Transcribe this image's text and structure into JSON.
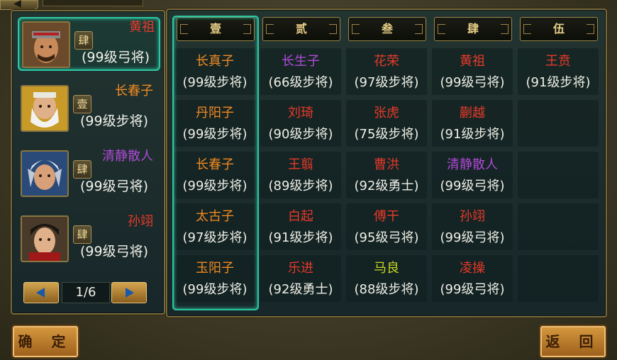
{
  "colors": {
    "red": "#e63a2a",
    "orange": "#f08a22",
    "purple": "#b04ad8",
    "yellow": "#c8d820",
    "teal": "#2cc6a2"
  },
  "confirm_label": "确 定",
  "back_label": "返 回",
  "hero_list": [
    {
      "name": "黄祖",
      "name_color": "red",
      "rank": "肆",
      "level": "(99级弓将)",
      "selected": true,
      "portrait": "warrior-red-headband-portrait"
    },
    {
      "name": "长春子",
      "name_color": "orange",
      "rank": "壹",
      "level": "(99级步将)",
      "selected": false,
      "portrait": "white-beard-elder-portrait"
    },
    {
      "name": "清静散人",
      "name_color": "purple",
      "rank": "肆",
      "level": "(99级弓将)",
      "selected": false,
      "portrait": "blue-helmet-warrior-portrait"
    },
    {
      "name": "孙翊",
      "name_color": "red",
      "rank": "肆",
      "level": "(99级弓将)",
      "selected": false,
      "portrait": "young-general-portrait"
    }
  ],
  "pager": {
    "text": "1/6"
  },
  "columns": [
    {
      "header": "壹",
      "cells": [
        {
          "name": "长真子",
          "color": "orange",
          "level": "(99级步将)"
        },
        {
          "name": "丹阳子",
          "color": "orange",
          "level": "(99级步将)"
        },
        {
          "name": "长春子",
          "color": "orange",
          "level": "(99级步将)"
        },
        {
          "name": "太古子",
          "color": "orange",
          "level": "(97级步将)"
        },
        {
          "name": "玉阳子",
          "color": "orange",
          "level": "(99级步将)"
        }
      ]
    },
    {
      "header": "贰",
      "cells": [
        {
          "name": "长生子",
          "color": "purple",
          "level": "(66级步将)"
        },
        {
          "name": "刘琦",
          "color": "red",
          "level": "(90级步将)"
        },
        {
          "name": "王翦",
          "color": "red",
          "level": "(89级步将)"
        },
        {
          "name": "白起",
          "color": "red",
          "level": "(91级步将)"
        },
        {
          "name": "乐进",
          "color": "red",
          "level": "(92级勇士)"
        }
      ]
    },
    {
      "header": "叁",
      "cells": [
        {
          "name": "花荣",
          "color": "red",
          "level": "(97级步将)"
        },
        {
          "name": "张虎",
          "color": "red",
          "level": "(75级步将)"
        },
        {
          "name": "曹洪",
          "color": "red",
          "level": "(92级勇士)"
        },
        {
          "name": "傅干",
          "color": "red",
          "level": "(95级弓将)"
        },
        {
          "name": "马良",
          "color": "yellow",
          "level": "(88级步将)"
        }
      ]
    },
    {
      "header": "肆",
      "cells": [
        {
          "name": "黄祖",
          "color": "red",
          "level": "(99级弓将)"
        },
        {
          "name": "蒯越",
          "color": "red",
          "level": "(91级步将)"
        },
        {
          "name": "清静散人",
          "color": "purple",
          "level": "(99级弓将)"
        },
        {
          "name": "孙翊",
          "color": "red",
          "level": "(99级弓将)"
        },
        {
          "name": "凌操",
          "color": "red",
          "level": "(99级弓将)"
        }
      ]
    },
    {
      "header": "伍",
      "cells": [
        {
          "name": "王贲",
          "color": "red",
          "level": "(91级步将)"
        },
        {
          "name": "",
          "color": "red",
          "level": ""
        },
        {
          "name": "",
          "color": "red",
          "level": ""
        },
        {
          "name": "",
          "color": "red",
          "level": ""
        },
        {
          "name": "",
          "color": "red",
          "level": ""
        }
      ]
    }
  ]
}
